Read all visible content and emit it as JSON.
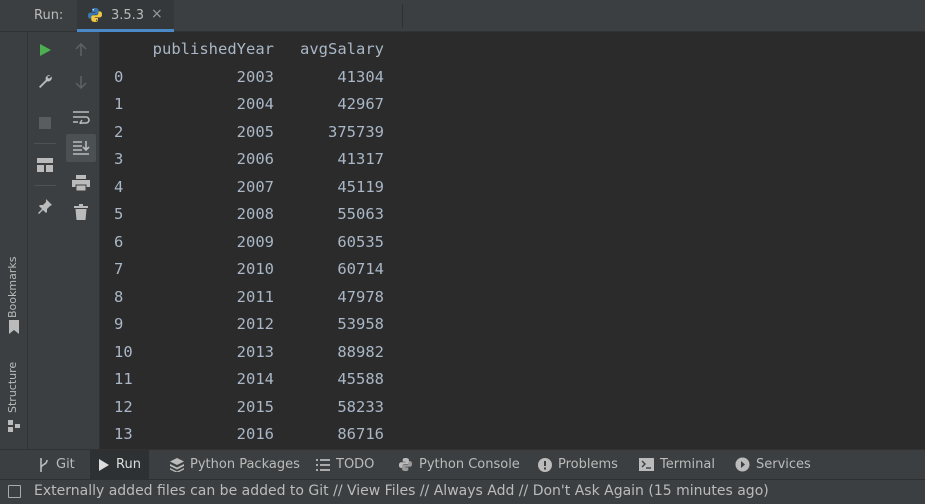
{
  "header": {
    "label": "Run:",
    "tab_label": "3.5.3",
    "tab_close": "×"
  },
  "side": {
    "bookmarks_label": "Bookmarks",
    "structure_label": "Structure"
  },
  "console": {
    "columns": [
      "publishedYear",
      "avgSalary"
    ],
    "rows": [
      {
        "index": "0",
        "year": "2003",
        "salary": "41304"
      },
      {
        "index": "1",
        "year": "2004",
        "salary": "42967"
      },
      {
        "index": "2",
        "year": "2005",
        "salary": "375739"
      },
      {
        "index": "3",
        "year": "2006",
        "salary": "41317"
      },
      {
        "index": "4",
        "year": "2007",
        "salary": "45119"
      },
      {
        "index": "5",
        "year": "2008",
        "salary": "55063"
      },
      {
        "index": "6",
        "year": "2009",
        "salary": "60535"
      },
      {
        "index": "7",
        "year": "2010",
        "salary": "60714"
      },
      {
        "index": "8",
        "year": "2011",
        "salary": "47978"
      },
      {
        "index": "9",
        "year": "2012",
        "salary": "53958"
      },
      {
        "index": "10",
        "year": "2013",
        "salary": "88982"
      },
      {
        "index": "11",
        "year": "2014",
        "salary": "45588"
      },
      {
        "index": "12",
        "year": "2015",
        "salary": "58233"
      },
      {
        "index": "13",
        "year": "2016",
        "salary": "86716"
      }
    ]
  },
  "bottom_tabs": [
    {
      "label": "Git",
      "icon": "git-branch-icon"
    },
    {
      "label": "Run",
      "icon": "run-icon"
    },
    {
      "label": "Python Packages",
      "icon": "packages-icon"
    },
    {
      "label": "TODO",
      "icon": "todo-list-icon"
    },
    {
      "label": "Python Console",
      "icon": "python-console-icon"
    },
    {
      "label": "Problems",
      "icon": "problems-icon"
    },
    {
      "label": "Terminal",
      "icon": "terminal-icon"
    },
    {
      "label": "Services",
      "icon": "services-icon"
    }
  ],
  "status": {
    "message": "Externally added files can be added to Git // View Files // Always Add // Don't Ask Again (15 minutes ago)"
  },
  "colors": {
    "accent": "#4a88c7",
    "run_green": "#4caf50",
    "console_text": "#a9b7c6",
    "background": "#2b2b2b",
    "panel": "#3c3f41"
  }
}
